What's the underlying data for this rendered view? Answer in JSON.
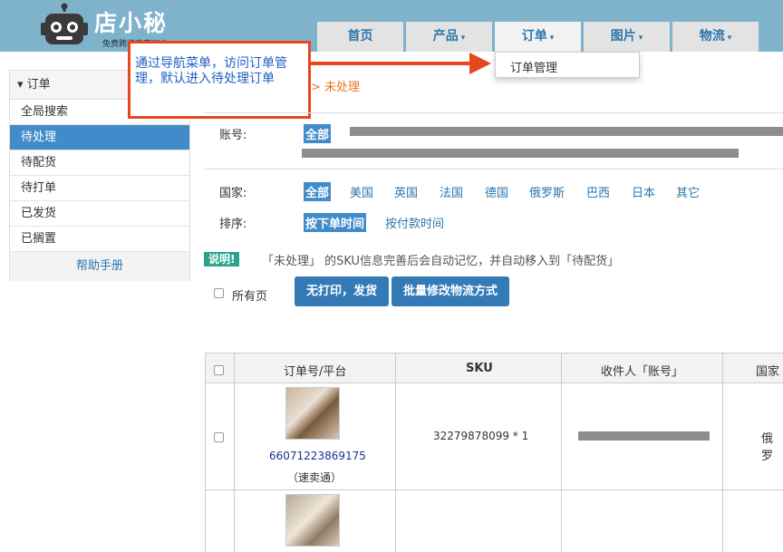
{
  "header": {
    "logo_text": "店小秘",
    "logo_sub": "免费跨境电商ERP",
    "nav": [
      {
        "label": "首页",
        "caret": ""
      },
      {
        "label": "产品",
        "caret": "▾"
      },
      {
        "label": "订单",
        "caret": "▾"
      },
      {
        "label": "图片",
        "caret": "▾"
      },
      {
        "label": "物流",
        "caret": "▾"
      }
    ],
    "dropdown_item": "订单管理"
  },
  "annotation": {
    "text": "通过导航菜单，访问订单管理，默认进入待处理订单"
  },
  "breadcrumb": "> 未处理",
  "sidebar": {
    "title": "订单",
    "items": [
      "全局搜索",
      "待处理",
      "待配货",
      "待打单",
      "已发货",
      "已搁置"
    ],
    "active_index": 1,
    "help": "帮助手册"
  },
  "filters": {
    "account_label": "账号:",
    "account_all": "全部",
    "country_label": "国家:",
    "countries": [
      "全部",
      "美国",
      "英国",
      "法国",
      "德国",
      "俄罗斯",
      "巴西",
      "日本",
      "其它"
    ],
    "sort_label": "排序:",
    "sorts": [
      "按下单时间",
      "按付款时间"
    ]
  },
  "note": {
    "badge": "说明!",
    "text": "「未处理」 的SKU信息完善后会自动记忆，并自动移入到「待配货」"
  },
  "actions": {
    "all_pages": "所有页",
    "btn_ship": "无打印，发货",
    "btn_modify": "批量修改物流方式"
  },
  "table": {
    "headers": [
      "订单号/平台",
      "SKU",
      "收件人「账号」",
      "国家"
    ],
    "rows": [
      {
        "order_no": "66071223869175",
        "platform": "（速卖通）",
        "sku": "32279878099 * 1",
        "country": "俄罗"
      }
    ]
  },
  "colors": {
    "header_bg": "#7fb2cb",
    "accent": "#428bca",
    "annotation": "#e8461d"
  }
}
